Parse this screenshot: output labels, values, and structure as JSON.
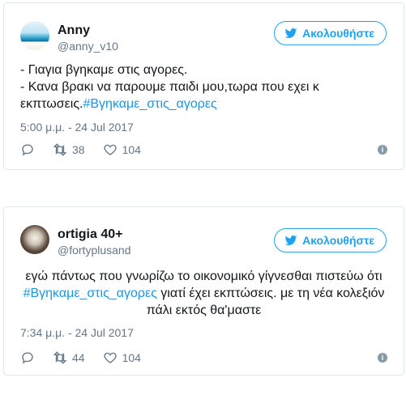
{
  "tweets": [
    {
      "name": "Anny",
      "handle": "@anny_v10",
      "follow_label": "Ακολουθήστε",
      "lines": [
        "- Γιαγια βγηκαμε στις αγορες.",
        "- Κανα βρακι να παρουμε παιδι μου,τωρα που εχει κ",
        "εκπτωσεις."
      ],
      "hashtag": "#Βγηκαμε_στις_αγορες",
      "time": "5:00 μ.μ. - 24 Jul 2017",
      "retweets": "38",
      "likes": "104",
      "info": "i"
    },
    {
      "name": "ortigia 40+",
      "handle": "@fortyplusand",
      "follow_label": "Ακολουθήστε",
      "line1": "εγώ πάντως που γνωρίζω το οικονομικό γίγνεσθαι πιστεύω ότι",
      "hashtag": "#Βγηκαμε_στις_αγορες",
      "line2_rest": " γιατί έχει εκπτώσεις. με τη νέα κολεξιόν",
      "line3": "πάλι εκτός θα'μαστε",
      "time": "7:34 μ.μ. - 24 Jul 2017",
      "retweets": "44",
      "likes": "104",
      "info": "i"
    }
  ],
  "colors": {
    "accent": "#1da1f2",
    "hashtag": "#1b95e0",
    "muted": "#657786"
  }
}
